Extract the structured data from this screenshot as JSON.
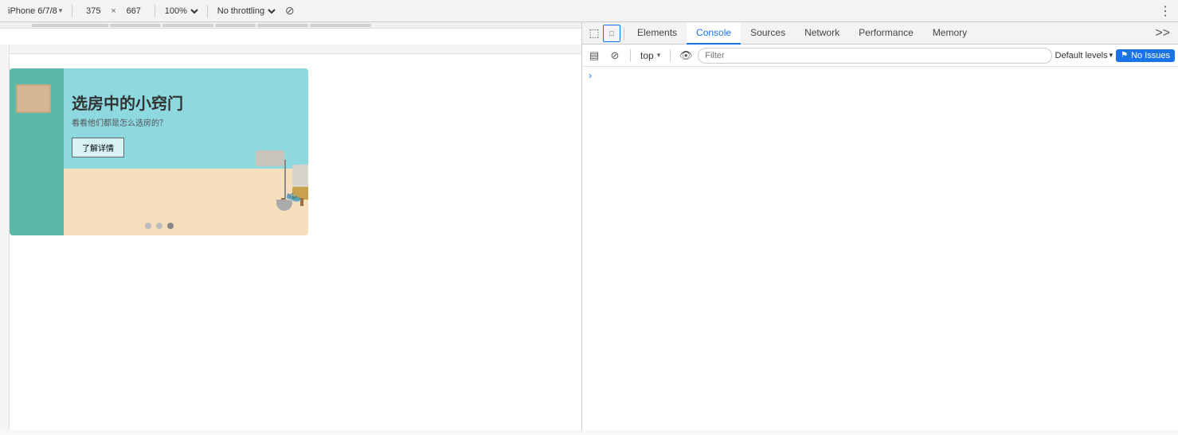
{
  "toolbar": {
    "device_label": "iPhone 6/7/8",
    "width_value": "375",
    "height_value": "667",
    "zoom_value": "100%",
    "throttle_value": "No throttling",
    "more_icon": "⋮"
  },
  "devtools": {
    "tabs": [
      {
        "id": "elements",
        "label": "Elements",
        "active": false
      },
      {
        "id": "console",
        "label": "Console",
        "active": true
      },
      {
        "id": "sources",
        "label": "Sources",
        "active": false
      },
      {
        "id": "network",
        "label": "Network",
        "active": false
      },
      {
        "id": "performance",
        "label": "Performance",
        "active": false
      },
      {
        "id": "memory",
        "label": "Memory",
        "active": false
      }
    ],
    "console": {
      "context_label": "top",
      "filter_placeholder": "Filter",
      "levels_label": "Default levels",
      "no_issues_label": "No Issues"
    }
  },
  "banner": {
    "title": "选房中的小窍门",
    "subtitle": "看看他们都是怎么选房的？",
    "button_label": "了解详情",
    "dots": [
      {
        "active": false
      },
      {
        "active": false
      },
      {
        "active": true
      }
    ]
  },
  "icons": {
    "cursor_icon": "⬝",
    "inspect_icon": "◻",
    "clear_icon": "🚫",
    "eye_icon": "👁",
    "chevron_down": "▾",
    "flag_icon": "⚑",
    "rotate_icon": "⟳"
  }
}
